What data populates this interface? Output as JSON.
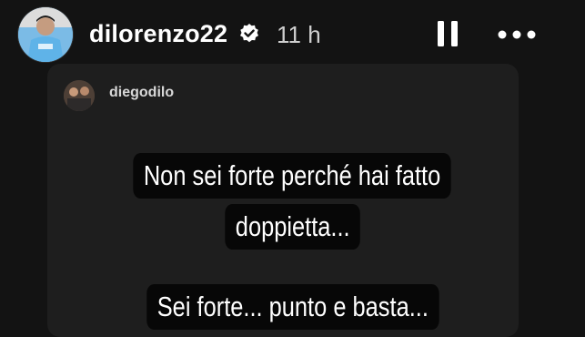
{
  "header": {
    "username": "dilorenzo22",
    "time": "11 h",
    "verified_color": "#ffffff",
    "avatar": "profile-avatar",
    "pause_icon": "pause-icon",
    "more_icon": "more-options-icon"
  },
  "shared_post": {
    "username": "diegodilo",
    "caption_lines": [
      "Non sei forte perché hai fatto",
      "doppietta...",
      "Sei forte... punto e basta..."
    ]
  },
  "colors": {
    "background": "#131313",
    "card": "#1e1e1e",
    "caption_bg": "#070707",
    "text": "#ffffff",
    "muted": "#cfcfcf"
  }
}
